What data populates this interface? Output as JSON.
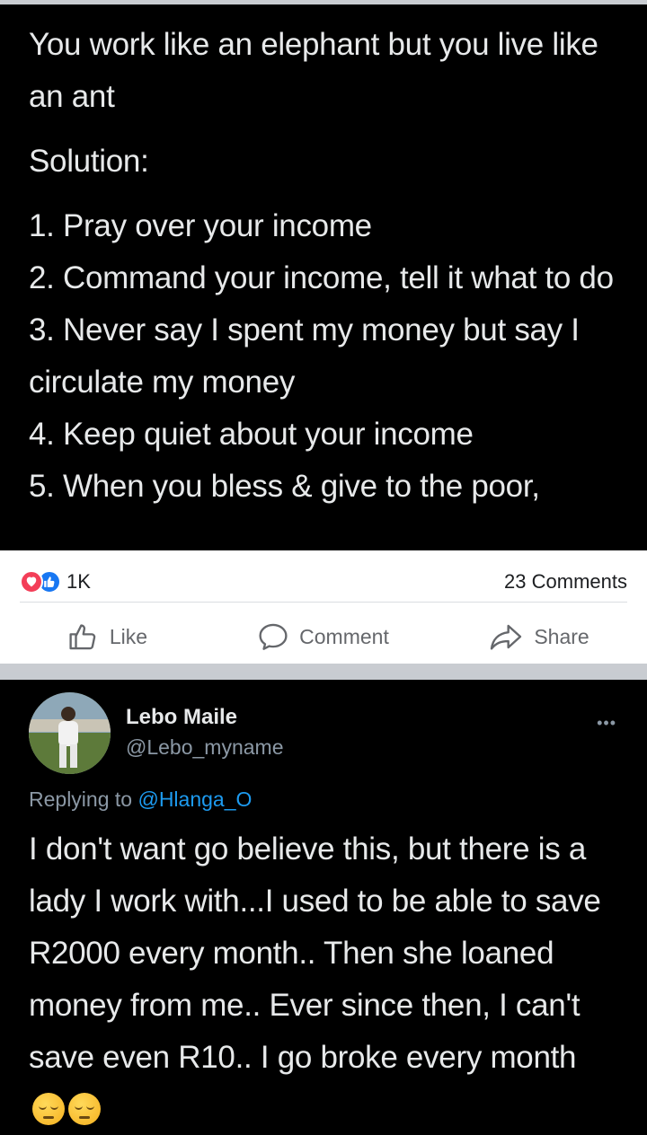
{
  "post": {
    "intro": "You work like an elephant but you live like an ant",
    "solution_label": "Solution:",
    "items": [
      "1. Pray over your income",
      "2. Command your income, tell it what to do",
      "3. Never say I spent my money but say I circulate my money",
      "4. Keep quiet about your income",
      "5. When you bless & give to the poor,"
    ]
  },
  "engagement": {
    "reaction_count": "1K",
    "comments_label": "23 Comments",
    "like_label": "Like",
    "comment_label": "Comment",
    "share_label": "Share",
    "colors": {
      "love": "#f33e58",
      "like": "#1877f2",
      "action_text": "#65676b"
    }
  },
  "tweet": {
    "author_name": "Lebo Maile",
    "author_handle": "@Lebo_myname",
    "reply_prefix": "Replying to",
    "reply_mention": "@Hlanga_O",
    "body": "I don't want go believe this, but there is a lady I work with...I used to be able to save R2000 every month.. Then she loaned money from me.. Ever since then, I can't save even R10.. I go broke every month",
    "emojis": [
      "pensive-face-icon",
      "pensive-face-icon"
    ],
    "colors": {
      "mention": "#1d9bf0",
      "muted": "#8b98a5"
    }
  }
}
